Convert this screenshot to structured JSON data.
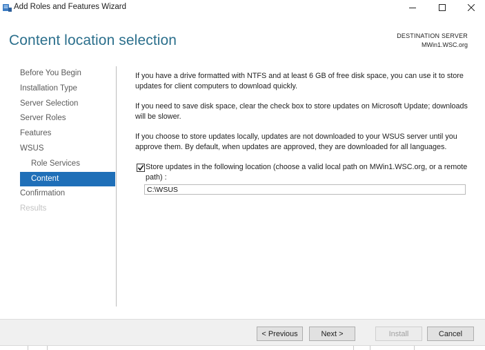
{
  "window": {
    "title": "Add Roles and Features Wizard",
    "icon": "server-manager-icon"
  },
  "header": {
    "page_title": "Content location selection",
    "destination_label": "DESTINATION SERVER",
    "destination_server": "MWin1.WSC.org"
  },
  "nav": {
    "items": [
      {
        "label": "Before You Begin",
        "state": "normal"
      },
      {
        "label": "Installation Type",
        "state": "normal"
      },
      {
        "label": "Server Selection",
        "state": "normal"
      },
      {
        "label": "Server Roles",
        "state": "normal"
      },
      {
        "label": "Features",
        "state": "normal"
      },
      {
        "label": "WSUS",
        "state": "normal"
      },
      {
        "label": "Role Services",
        "state": "sub"
      },
      {
        "label": "Content",
        "state": "active"
      },
      {
        "label": "Confirmation",
        "state": "normal"
      },
      {
        "label": "Results",
        "state": "disabled"
      }
    ]
  },
  "content": {
    "para1": "If you have a drive formatted with NTFS and at least 6 GB of free disk space, you can use it to store updates for client computers to download quickly.",
    "para2": "If you need to save disk space, clear the check box to store updates on Microsoft Update; downloads will be slower.",
    "para3": "If you choose to store updates locally, updates are not downloaded to your WSUS server until you approve them. By default, when updates are approved, they are downloaded for all languages.",
    "checkbox_label": "Store updates in the following location (choose a valid local path on MWin1.WSC.org, or a remote path) :",
    "checkbox_checked": true,
    "path_value": "C:\\WSUS"
  },
  "footer": {
    "previous_label": "< Previous",
    "next_label": "Next >",
    "install_label": "Install",
    "cancel_label": "Cancel"
  },
  "colors": {
    "title_accent": "#2b6f8c",
    "nav_active_bg": "#1f6fb8"
  }
}
